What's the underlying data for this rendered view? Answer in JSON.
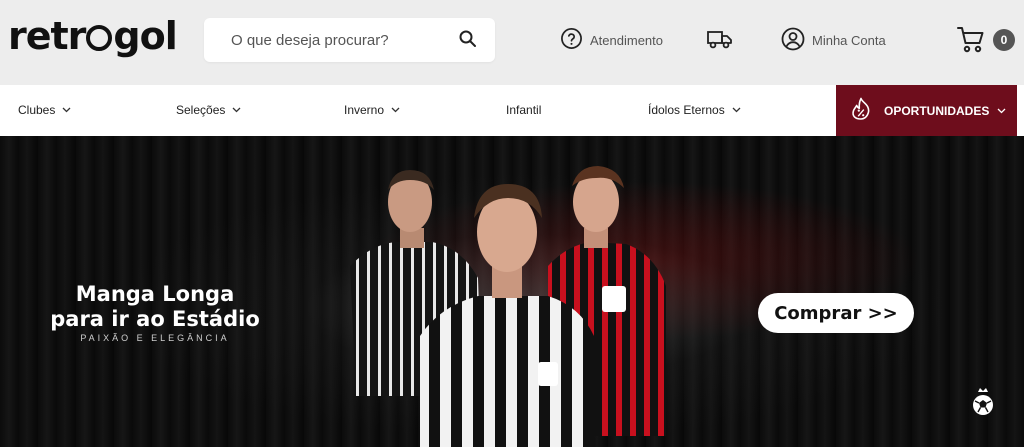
{
  "header": {
    "logo_text_a": "retr",
    "logo_text_b": "gol",
    "search_placeholder": "O que deseja procurar?",
    "search_icon": "search-icon",
    "support_label": "Atendimento",
    "support_icon": "help-circle-icon",
    "delivery_icon": "truck-icon",
    "account_label": "Minha Conta",
    "account_icon": "user-circle-icon",
    "cart_icon": "cart-icon",
    "cart_count": "0"
  },
  "nav": {
    "items": [
      {
        "label": "Clubes",
        "dropdown": true
      },
      {
        "label": "Seleções",
        "dropdown": true
      },
      {
        "label": "Inverno",
        "dropdown": true
      },
      {
        "label": "Infantil",
        "dropdown": false
      },
      {
        "label": "Ídolos Eternos",
        "dropdown": true
      }
    ],
    "opportunities_label": "OPORTUNIDADES",
    "opportunities_icon": "discount-flame-icon"
  },
  "hero": {
    "title_line1": "Manga Longa",
    "title_line2": "para ir ao Estádio",
    "subtitle": "PAIXÃO E ELEGÂNCIA",
    "button_label": "Comprar >>",
    "corner_icon": "soccer-ball-crown-icon"
  },
  "colors": {
    "topbar": "#ededed",
    "accent": "#6e0d1c",
    "hero_bg": "#0a0a0a"
  }
}
